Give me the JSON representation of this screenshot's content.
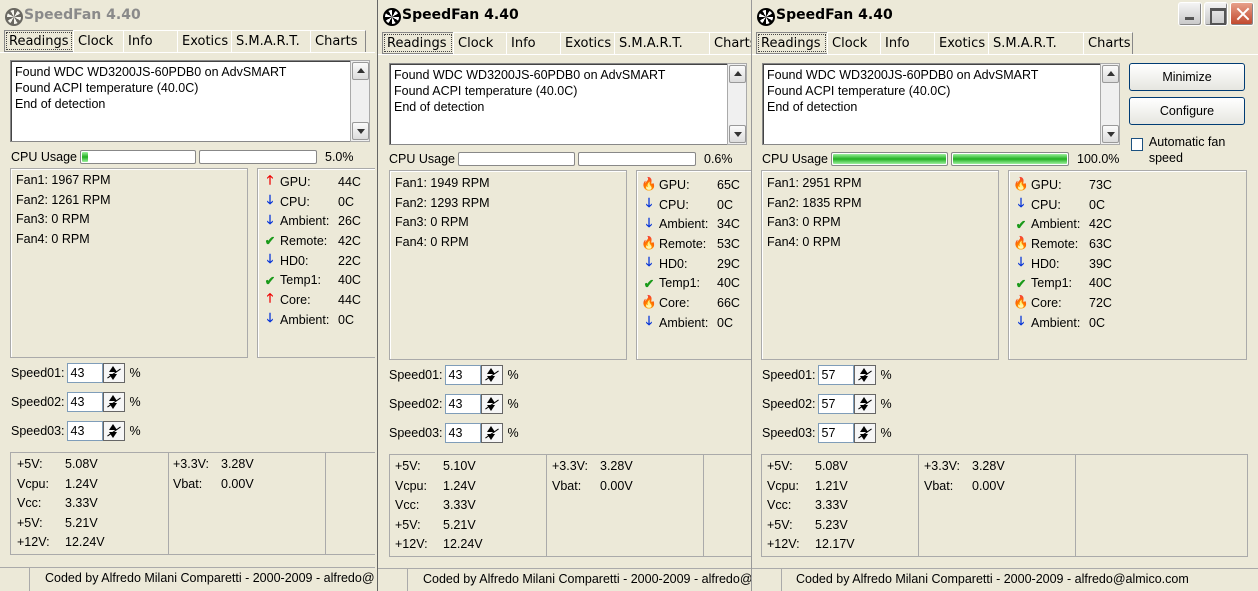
{
  "app_title": "SpeedFan 4.40",
  "tabs": [
    "Readings",
    "Clock",
    "Info",
    "Exotics",
    "S.M.A.R.T.",
    "Charts"
  ],
  "log_lines": [
    "Found WDC WD3200JS-60PDB0 on AdvSMART",
    "Found ACPI temperature (40.0C)",
    "End of detection"
  ],
  "cpu_label": "CPU Usage",
  "speed_labels": [
    "Speed01:",
    "Speed02:",
    "Speed03:"
  ],
  "percent_sign": "%",
  "status_text": "Coded by Alfredo Milani Comparetti - 2000-2009 - alfredo@almico.com",
  "buttons": {
    "minimize": "Minimize",
    "configure": "Configure"
  },
  "auto_fan": "Automatic fan speed",
  "colors": {
    "up_arrow": "#e00000",
    "down_arrow": "#0030d8",
    "ok_check": "#1a9a1a",
    "flame": "#f25a00",
    "cpu_bar": "#22b022"
  },
  "windows": [
    {
      "cpu_bars": [
        0.05,
        0
      ],
      "cpu_pct": "5.0%",
      "fans": [
        "Fan1: 1967 RPM",
        "Fan2: 1261 RPM",
        "Fan3: 0 RPM",
        "Fan4: 0 RPM"
      ],
      "temps": [
        {
          "icon": "up-arrow",
          "name": "GPU:",
          "value": "44C"
        },
        {
          "icon": "down-arrow",
          "name": "CPU:",
          "value": "0C"
        },
        {
          "icon": "down-arrow",
          "name": "Ambient:",
          "value": "26C"
        },
        {
          "icon": "check",
          "name": "Remote:",
          "value": "42C"
        },
        {
          "icon": "down-arrow",
          "name": "HD0:",
          "value": "22C"
        },
        {
          "icon": "check",
          "name": "Temp1:",
          "value": "40C"
        },
        {
          "icon": "up-arrow",
          "name": "Core:",
          "value": "44C"
        },
        {
          "icon": "down-arrow",
          "name": "Ambient:",
          "value": "0C"
        }
      ],
      "speeds": [
        "43",
        "43",
        "43"
      ],
      "volts_left": [
        [
          "+5V:",
          "5.08V"
        ],
        [
          "Vcpu:",
          "1.24V"
        ],
        [
          "Vcc:",
          "3.33V"
        ],
        [
          "+5V:",
          "5.21V"
        ],
        [
          "+12V:",
          "12.24V"
        ]
      ],
      "volts_right": [
        [
          "+3.3V:",
          "3.28V"
        ],
        [
          "Vbat:",
          "0.00V"
        ]
      ]
    },
    {
      "cpu_bars": [
        0,
        0
      ],
      "cpu_pct": "0.6%",
      "fans": [
        "Fan1: 1949 RPM",
        "Fan2: 1293 RPM",
        "Fan3: 0 RPM",
        "Fan4: 0 RPM"
      ],
      "temps": [
        {
          "icon": "flame",
          "name": "GPU:",
          "value": "65C"
        },
        {
          "icon": "down-arrow",
          "name": "CPU:",
          "value": "0C"
        },
        {
          "icon": "down-arrow",
          "name": "Ambient:",
          "value": "34C"
        },
        {
          "icon": "flame",
          "name": "Remote:",
          "value": "53C"
        },
        {
          "icon": "down-arrow",
          "name": "HD0:",
          "value": "29C"
        },
        {
          "icon": "check",
          "name": "Temp1:",
          "value": "40C"
        },
        {
          "icon": "flame",
          "name": "Core:",
          "value": "66C"
        },
        {
          "icon": "down-arrow",
          "name": "Ambient:",
          "value": "0C"
        }
      ],
      "speeds": [
        "43",
        "43",
        "43"
      ],
      "volts_left": [
        [
          "+5V:",
          "5.10V"
        ],
        [
          "Vcpu:",
          "1.24V"
        ],
        [
          "Vcc:",
          "3.33V"
        ],
        [
          "+5V:",
          "5.21V"
        ],
        [
          "+12V:",
          "12.24V"
        ]
      ],
      "volts_right": [
        [
          "+3.3V:",
          "3.28V"
        ],
        [
          "Vbat:",
          "0.00V"
        ]
      ]
    },
    {
      "cpu_bars": [
        1,
        1
      ],
      "cpu_pct": "100.0%",
      "fans": [
        "Fan1: 2951 RPM",
        "Fan2: 1835 RPM",
        "Fan3: 0 RPM",
        "Fan4: 0 RPM"
      ],
      "temps": [
        {
          "icon": "flame",
          "name": "GPU:",
          "value": "73C"
        },
        {
          "icon": "down-arrow",
          "name": "CPU:",
          "value": "0C"
        },
        {
          "icon": "check",
          "name": "Ambient:",
          "value": "42C"
        },
        {
          "icon": "flame",
          "name": "Remote:",
          "value": "63C"
        },
        {
          "icon": "down-arrow",
          "name": "HD0:",
          "value": "39C"
        },
        {
          "icon": "check",
          "name": "Temp1:",
          "value": "40C"
        },
        {
          "icon": "flame",
          "name": "Core:",
          "value": "72C"
        },
        {
          "icon": "down-arrow",
          "name": "Ambient:",
          "value": "0C"
        }
      ],
      "speeds": [
        "57",
        "57",
        "57"
      ],
      "volts_left": [
        [
          "+5V:",
          "5.08V"
        ],
        [
          "Vcpu:",
          "1.21V"
        ],
        [
          "Vcc:",
          "3.33V"
        ],
        [
          "+5V:",
          "5.23V"
        ],
        [
          "+12V:",
          "12.17V"
        ]
      ],
      "volts_right": [
        [
          "+3.3V:",
          "3.28V"
        ],
        [
          "Vbat:",
          "0.00V"
        ]
      ]
    }
  ]
}
